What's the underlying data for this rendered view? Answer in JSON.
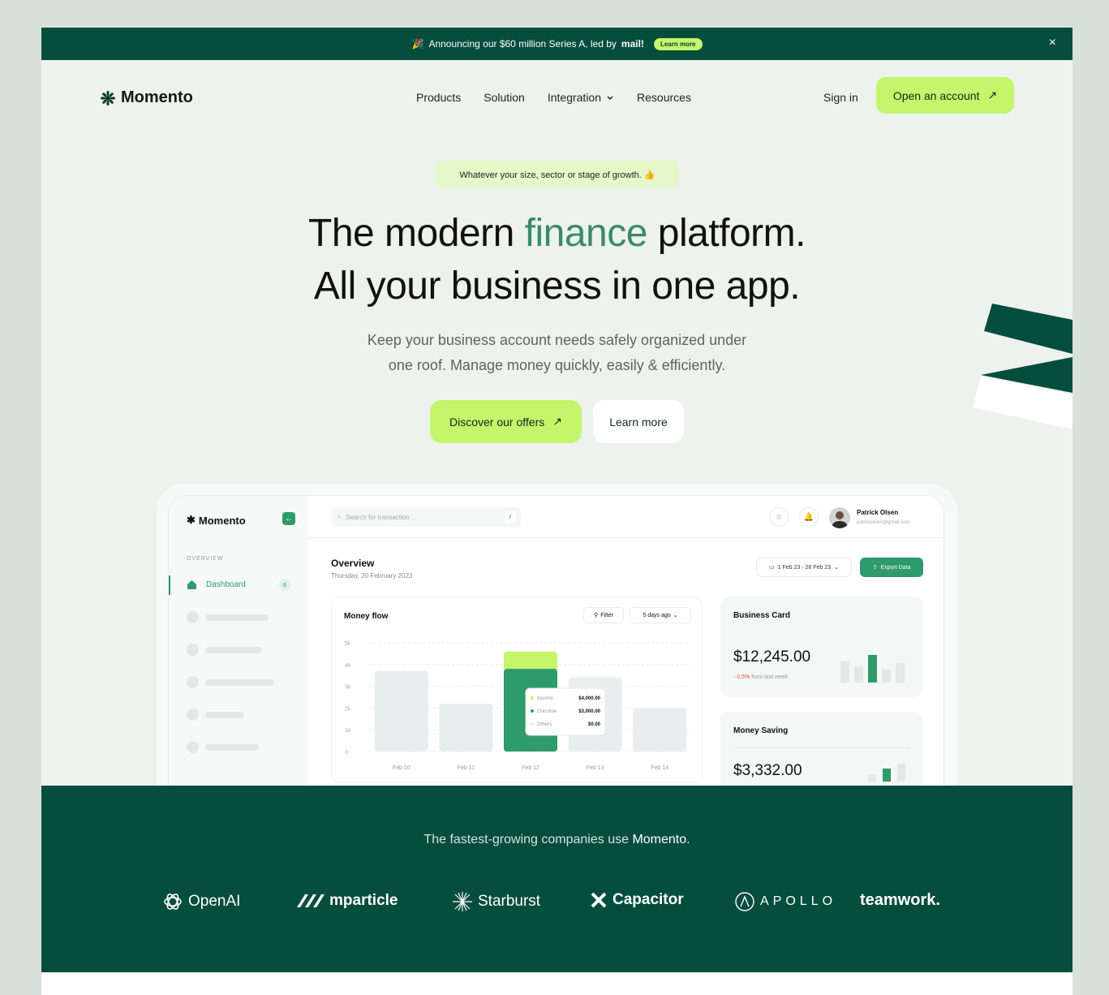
{
  "announcement": {
    "emoji": "🎉",
    "text": "Announcing our $60 million Series A, led by",
    "brand": "mail!",
    "cta": "Learn more",
    "close": "×"
  },
  "nav": {
    "logo": "Momento",
    "items": [
      "Products",
      "Solution",
      "Integration",
      "Resources"
    ],
    "sign_in": "Sign in",
    "open_account": "Open an account",
    "arrow": "↗"
  },
  "hero": {
    "tagline": "Whatever your size, sector or stage of growth. 👍",
    "title_line1_a": "The modern ",
    "title_accent": "finance",
    "title_line1_b": " platform.",
    "title_line2": "All your business in one app.",
    "subtitle_line1": "Keep your business account needs safely organized under",
    "subtitle_line2": "one roof. Manage money quickly, easily & efficiently.",
    "cta_primary": "Discover our offers",
    "cta_secondary": "Learn more"
  },
  "dashboard": {
    "logo": "Momento",
    "collapse_icon": "←",
    "section_label": "OVERVIEW",
    "active_item": "Dashboard",
    "active_badge": "6",
    "search_placeholder": "Search for transaction ...",
    "search_key": "/",
    "user_name": "Patrick Olsen",
    "user_email": "patrickolsen@gmail.com",
    "page_title": "Overview",
    "page_date": "Thursday, 20 February 2023",
    "date_range": "1 Feb 23 - 28 Feb 23",
    "export": "Export Data",
    "money_flow": {
      "title": "Money flow",
      "filter": "Filter",
      "range": "5 days ago"
    },
    "business_card": {
      "title": "Business Card",
      "value": "$12,245.00",
      "change": "- 0.5%",
      "change_suffix": " from last week"
    },
    "money_saving": {
      "title": "Money Saving",
      "value": "$3,332.00"
    },
    "tooltip": [
      {
        "label": "Income",
        "value": "$4,000.00",
        "color": "#c4f56a"
      },
      {
        "label": "Outcome",
        "value": "$3,000.00",
        "color": "#2f9a6c"
      },
      {
        "label": "Others",
        "value": "$0.00",
        "color": "#e3e8e5"
      }
    ]
  },
  "chart_data": {
    "type": "bar",
    "categories": [
      "Feb 10",
      "Feb 11",
      "Feb 12",
      "Feb 13",
      "Feb 14"
    ],
    "series": [
      {
        "values": [
          3.7,
          2.2,
          3.8,
          3.4,
          2.0
        ]
      },
      {
        "values": [
          0,
          0,
          0.8,
          0,
          0
        ]
      }
    ],
    "y_ticks": [
      "0",
      "1k",
      "2k",
      "3k",
      "4k",
      "5k"
    ],
    "ylim": [
      0,
      5
    ],
    "highlight_index": 2,
    "colors": {
      "base": "#e8edf0",
      "highlight": "#2f9a6c",
      "top": "#c4f56a"
    }
  },
  "companies": {
    "caption_a": "The fastest-growing companies use ",
    "caption_b": "Momento.",
    "logos": [
      "OpenAI",
      "mparticle",
      "Starburst",
      "Capacitor",
      "APOLLO",
      "teamwork."
    ]
  },
  "colors": {
    "brand_dark": "#054d3c",
    "accent_lime": "#c4f56a",
    "accent_green": "#2f9a6c",
    "finance_text": "#3a8a6a"
  }
}
